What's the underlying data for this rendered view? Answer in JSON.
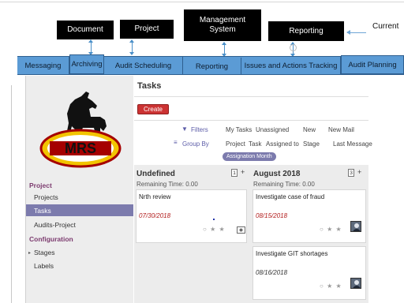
{
  "annotations": {
    "document": "Document",
    "project": "Project",
    "management_system": "Management System",
    "reporting": "Reporting",
    "current": "Current"
  },
  "nav_tabs": [
    "Messaging",
    "Archiving",
    "Audit Scheduling",
    "Reporting",
    "Issues and Actions Tracking",
    "Audit Planning"
  ],
  "logo": {
    "text": "MRS"
  },
  "sidebar": {
    "sections": [
      {
        "label": "Project",
        "items": [
          "Projects",
          "Tasks",
          "Audits-Project"
        ]
      },
      {
        "label": "Configuration",
        "items": [
          "Stages",
          "Labels"
        ]
      }
    ],
    "active_item": "Tasks"
  },
  "main": {
    "title": "Tasks",
    "create_label": "Create",
    "filters_label": "Filters",
    "filters": [
      "My Tasks",
      "Unassigned",
      "New",
      "New Mail"
    ],
    "group_by_label": "Group By",
    "group_by": [
      "Project",
      "Task",
      "Assigned to",
      "Stage",
      "Last Message"
    ],
    "active_group_chip": "Assignation Month"
  },
  "kanban": {
    "columns": [
      {
        "title": "Undefined",
        "count": "1",
        "remaining": "Remaining Time: 0.00",
        "cards": [
          {
            "name": "Nrth review",
            "date": "07/30/2018",
            "overdue": true
          }
        ]
      },
      {
        "title": "August 2018",
        "count": "3",
        "remaining": "Remaining Time: 0.00",
        "cards": [
          {
            "name": "Investigate case of fraud",
            "date": "08/15/2018",
            "overdue": true
          },
          {
            "name": "Investigate GIT shortages",
            "date": "08/16/2018",
            "overdue": false
          }
        ]
      }
    ]
  },
  "colors": {
    "nav_strip": "#5b9bd5",
    "sidebar_active": "#7c7bad",
    "create_button": "#cc3333",
    "overdue_date": "#b11b1b",
    "section_header": "#7c3b6f"
  }
}
